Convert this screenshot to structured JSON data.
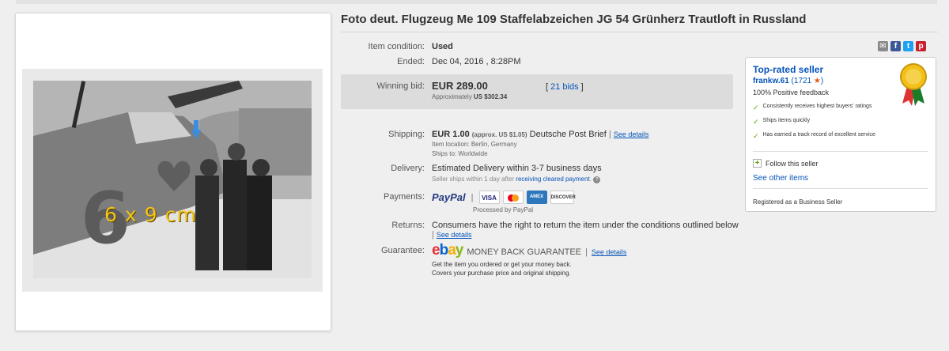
{
  "title": "Foto deut. Flugzeug Me 109 Staffelabzeichen JG 54 Grünherz Trautloft in Russland",
  "photo": {
    "caption": "6 x 9 cm"
  },
  "condition": {
    "label": "Item condition:",
    "value": "Used"
  },
  "ended": {
    "label": "Ended:",
    "value": "Dec 04, 2016 , 8:28PM"
  },
  "bid": {
    "label": "Winning bid:",
    "amount": "EUR 289.00",
    "approx_label": "Approximately",
    "approx_value": "US $302.34",
    "bids_link": "21 bids"
  },
  "shipping": {
    "label": "Shipping:",
    "cost": "EUR 1.00",
    "approx": "(approx. US $1.05)",
    "service": "Deutsche Post Brief",
    "see_details": "See details",
    "location_label": "Item location:",
    "location": "Berlin, Germany",
    "ships_to_label": "Ships to:",
    "ships_to": "Worldwide"
  },
  "delivery": {
    "label": "Delivery:",
    "estimate": "Estimated Delivery within 3-7 business days",
    "note_prefix": "Seller ships within 1 day after",
    "note_link": "receiving cleared payment",
    "note_suffix": "."
  },
  "payments": {
    "label": "Payments:",
    "paypal": "PayPal",
    "processed": "Processed by PayPal",
    "cards": [
      "VISA",
      "MC",
      "AMEX",
      "DISCOVER"
    ]
  },
  "returns": {
    "label": "Returns:",
    "text": "Consumers have the right to return the item under the conditions outlined below",
    "see_details": "See details"
  },
  "guarantee": {
    "label": "Guarantee:",
    "logo": "ebay",
    "title": "MONEY BACK GUARANTEE",
    "see_details": "See details",
    "line1": "Get the item you ordered or get your money back.",
    "line2": "Covers your purchase price and original shipping."
  },
  "seller": {
    "heading": "Top-rated seller",
    "name": "frankw.61",
    "score": "(1721",
    "score_close": ")",
    "feedback": "100% Positive feedback",
    "points": [
      "Consistently receives highest buyers' ratings",
      "Ships items quickly",
      "Has earned a track record of excellent service"
    ],
    "follow": "Follow this seller",
    "other_items": "See other items",
    "business": "Registered as a Business Seller"
  },
  "colors": {
    "link": "#0654ba",
    "check": "#5ba700",
    "paypal_dark": "#253b80",
    "paypal_light": "#179bd7"
  }
}
